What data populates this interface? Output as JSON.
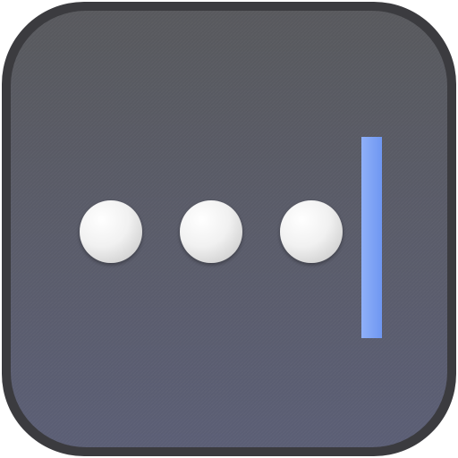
{
  "app_icon": {
    "icon": "password-field-icon",
    "colors": {
      "outer_border": "#3b3b3f",
      "background_top": "#58595d",
      "background_bottom": "#5b5e75",
      "dot_light": "#f7f7f7",
      "dot_shadow": "#cfcfcf",
      "cursor": "#6f97f2",
      "cursor_highlight": "#8fb0f8"
    },
    "masked_characters": 3
  }
}
